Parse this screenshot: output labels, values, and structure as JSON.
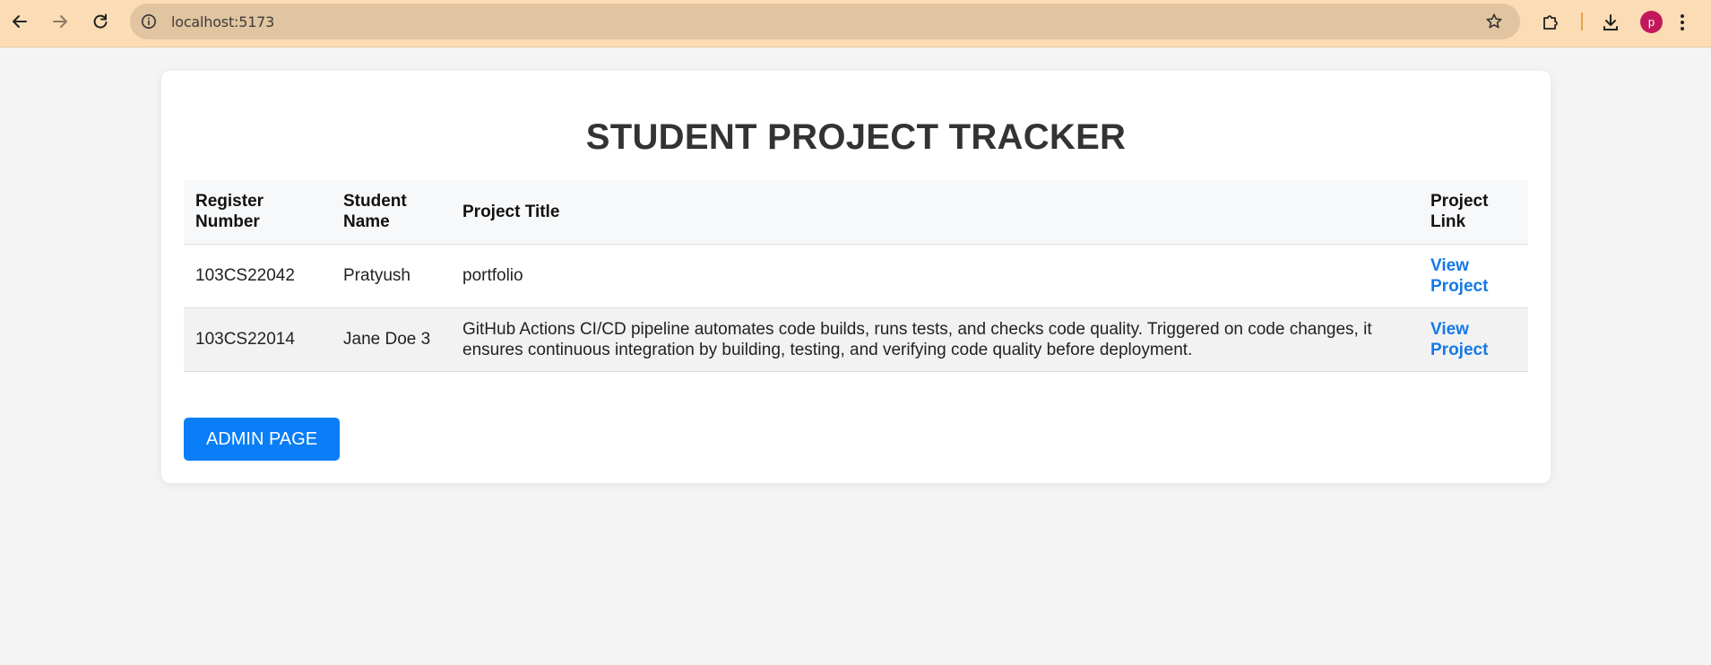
{
  "browser": {
    "url": "localhost:5173",
    "profile_initial": "p",
    "icons": [
      "back-arrow-icon",
      "forward-arrow-icon",
      "reload-icon",
      "site-info-icon",
      "bookmark-star-icon",
      "extensions-icon",
      "download-icon",
      "more-menu-icon"
    ]
  },
  "page": {
    "title": "STUDENT PROJECT TRACKER",
    "admin_button_label": "ADMIN PAGE"
  },
  "table": {
    "headers": [
      "Register Number",
      "Student Name",
      "Project Title",
      "Project Link"
    ],
    "rows": [
      {
        "register_number": "103CS22042",
        "student_name": "Pratyush",
        "project_title": "portfolio",
        "link_label": "View Project"
      },
      {
        "register_number": "103CS22014",
        "student_name": "Jane Doe 3",
        "project_title": "GitHub Actions CI/CD pipeline automates code builds, runs tests, and checks code quality. Triggered on code changes, it ensures continuous integration by building, testing, and verifying code quality before deployment.",
        "link_label": "View Project"
      }
    ]
  },
  "colors": {
    "toolbar": "#fcdcb4",
    "omnibox": "#e1c4a0",
    "link": "#1479e8",
    "button": "#0a7ef7",
    "avatar": "#c2185b"
  }
}
